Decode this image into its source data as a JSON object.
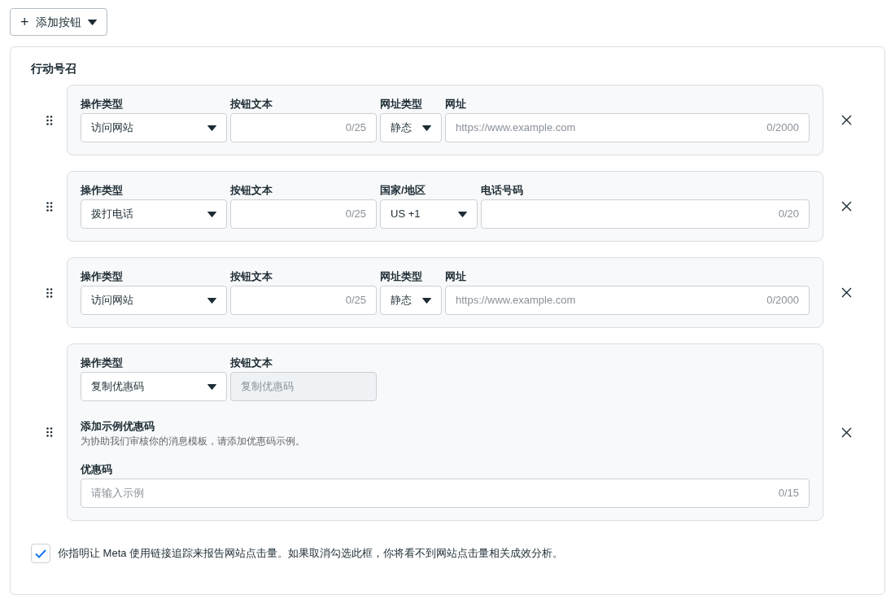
{
  "add_button": {
    "icon": "+",
    "label": "添加按钮"
  },
  "section": {
    "title": "行动号召",
    "cards": [
      {
        "kind": "website",
        "fields": [
          {
            "kind": "select",
            "label": "操作类型",
            "value": "访问网站"
          },
          {
            "kind": "text",
            "label": "按钮文本",
            "counter": "0/25",
            "disabled": false
          },
          {
            "kind": "select",
            "label": "网址类型",
            "value": "静态"
          },
          {
            "kind": "text",
            "label": "网址",
            "placeholder": "https://www.example.com",
            "counter": "0/2000",
            "disabled": false
          }
        ]
      },
      {
        "kind": "phone",
        "fields": [
          {
            "kind": "select",
            "label": "操作类型",
            "value": "拨打电话"
          },
          {
            "kind": "text",
            "label": "按钮文本",
            "counter": "0/25",
            "disabled": false
          },
          {
            "kind": "select",
            "label": "国家/地区",
            "value": "US +1"
          },
          {
            "kind": "text",
            "label": "电话号码",
            "counter": "0/20",
            "disabled": false
          }
        ]
      },
      {
        "kind": "website",
        "fields": [
          {
            "kind": "select",
            "label": "操作类型",
            "value": "访问网站"
          },
          {
            "kind": "text",
            "label": "按钮文本",
            "counter": "0/25",
            "disabled": false
          },
          {
            "kind": "select",
            "label": "网址类型",
            "value": "静态"
          },
          {
            "kind": "text",
            "label": "网址",
            "placeholder": "https://www.example.com",
            "counter": "0/2000",
            "disabled": false
          }
        ]
      },
      {
        "kind": "coupon",
        "fields": [
          {
            "kind": "select",
            "label": "操作类型",
            "value": "复制优惠码"
          },
          {
            "kind": "text",
            "label": "按钮文本",
            "value": "复制优惠码",
            "disabled": true
          }
        ],
        "sample": {
          "title": "添加示例优惠码",
          "description": "为协助我们审核你的消息模板，请添加优惠码示例。",
          "field": {
            "label": "优惠码",
            "placeholder": "请输入示例",
            "counter": "0/15"
          }
        }
      }
    ],
    "consent": {
      "checked": true,
      "label": "你指明让 Meta 使用链接追踪来报告网站点击量。如果取消勾选此框，你将看不到网站点击量相关成效分析。"
    }
  }
}
